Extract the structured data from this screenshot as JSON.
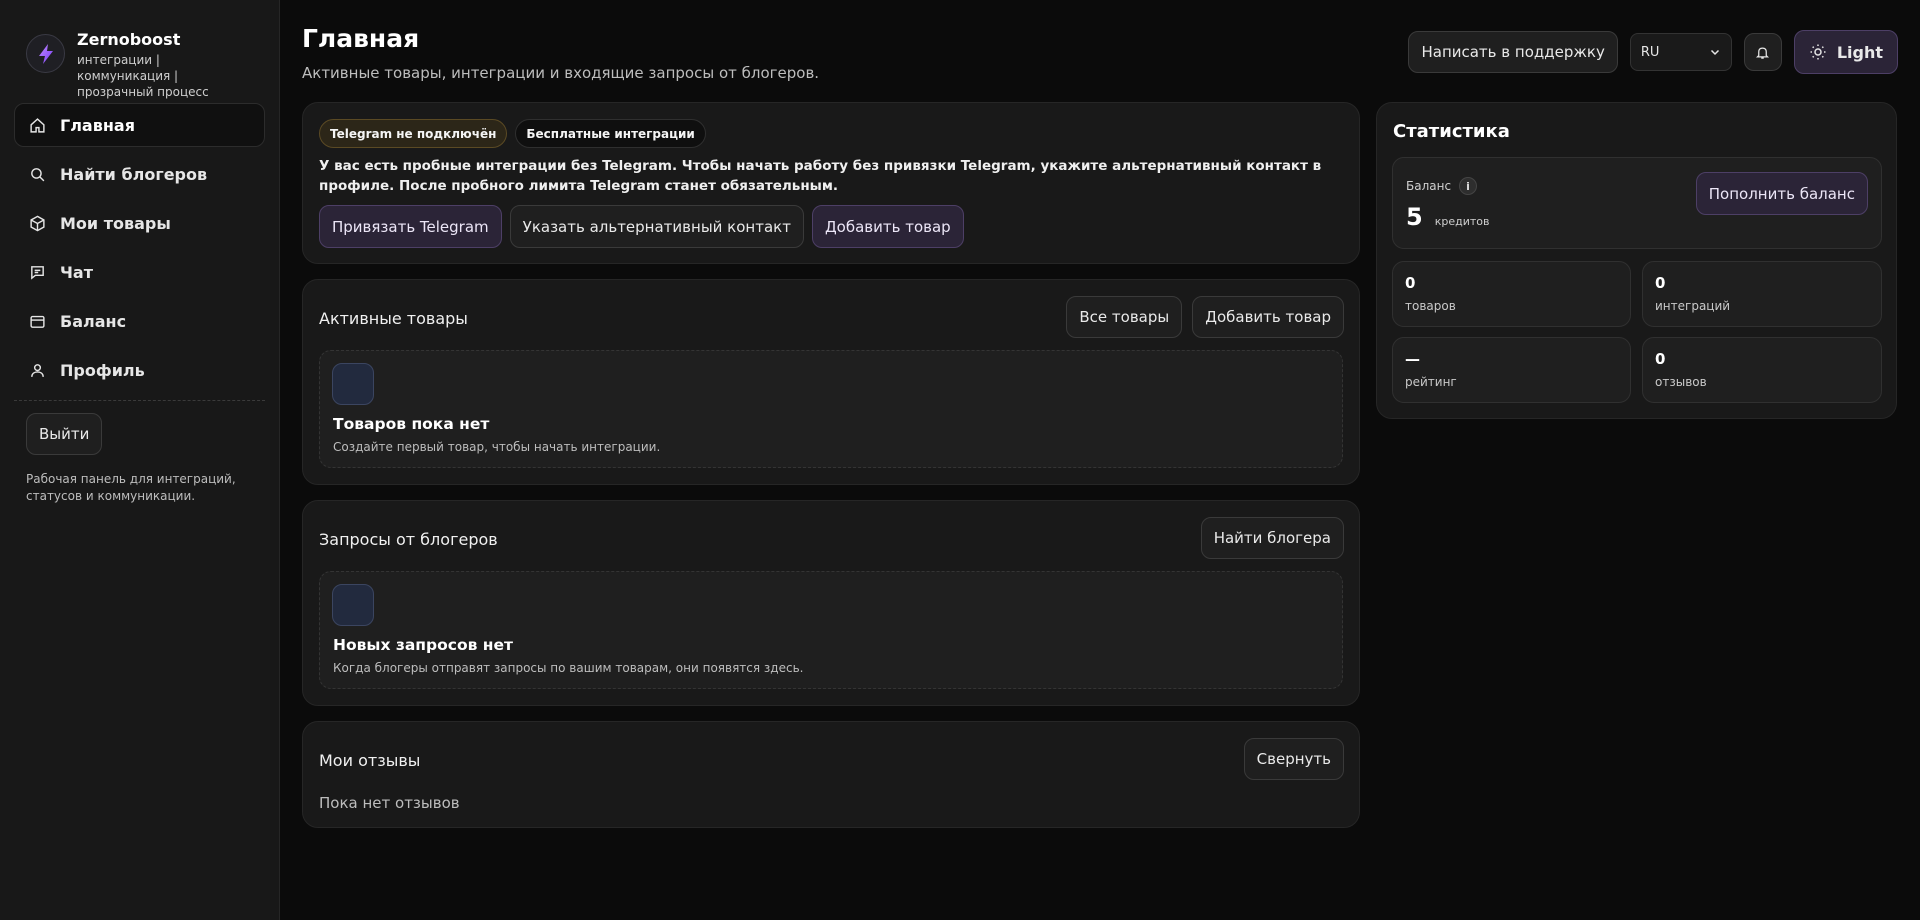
{
  "brand": {
    "name": "Zernoboost",
    "tagline": "интеграции | коммуникация | прозрачный процесс"
  },
  "sidebar": {
    "items": [
      {
        "label": "Главная",
        "icon": "home-icon"
      },
      {
        "label": "Найти блогеров",
        "icon": "search-icon"
      },
      {
        "label": "Мои товары",
        "icon": "box-icon"
      },
      {
        "label": "Чат",
        "icon": "chat-icon"
      },
      {
        "label": "Баланс",
        "icon": "wallet-icon"
      },
      {
        "label": "Профиль",
        "icon": "user-icon"
      }
    ],
    "logout_label": "Выйти",
    "note": "Рабочая панель для интеграций, статусов и коммуникации."
  },
  "header": {
    "title": "Главная",
    "subtitle": "Активные товары, интеграции и входящие запросы от блогеров.",
    "support_label": "Написать в поддержку",
    "language_value": "RU",
    "theme_label": "Light"
  },
  "onboarding": {
    "badge_telegram": "Telegram не подключён",
    "badge_free": "Бесплатные интеграции",
    "notice": "У вас есть пробные интеграции без Telegram. Чтобы начать работу без привязки Telegram, укажите альтернативный контакт в профиле. После пробного лимита Telegram станет обязательным.",
    "bind_telegram_label": "Привязать Telegram",
    "alt_contact_label": "Указать альтернативный контакт",
    "add_product_label": "Добавить товар"
  },
  "active_products": {
    "title": "Активные товары",
    "all_label": "Все товары",
    "add_label": "Добавить товар",
    "empty_title": "Товаров пока нет",
    "empty_sub": "Создайте первый товар, чтобы начать интеграции."
  },
  "requests": {
    "title": "Запросы от блогеров",
    "find_label": "Найти блогера",
    "empty_title": "Новых запросов нет",
    "empty_sub": "Когда блогеры отправят запросы по вашим товарам, они появятся здесь."
  },
  "reviews": {
    "title": "Мои отзывы",
    "collapse_label": "Свернуть",
    "empty": "Пока нет отзывов"
  },
  "stats": {
    "title": "Статистика",
    "balance_label": "Баланс",
    "balance_value": "5",
    "balance_unit": "кредитов",
    "topup_label": "Пополнить баланс",
    "cards": [
      {
        "value": "0",
        "label": "товаров"
      },
      {
        "value": "0",
        "label": "интеграций"
      },
      {
        "value": "—",
        "label": "рейтинг"
      },
      {
        "value": "0",
        "label": "отзывов"
      }
    ]
  },
  "colors": {
    "accent": "#2b2437",
    "accent_border": "#4d3f66",
    "bg": "#0b0b0b",
    "panel": "#191919"
  }
}
